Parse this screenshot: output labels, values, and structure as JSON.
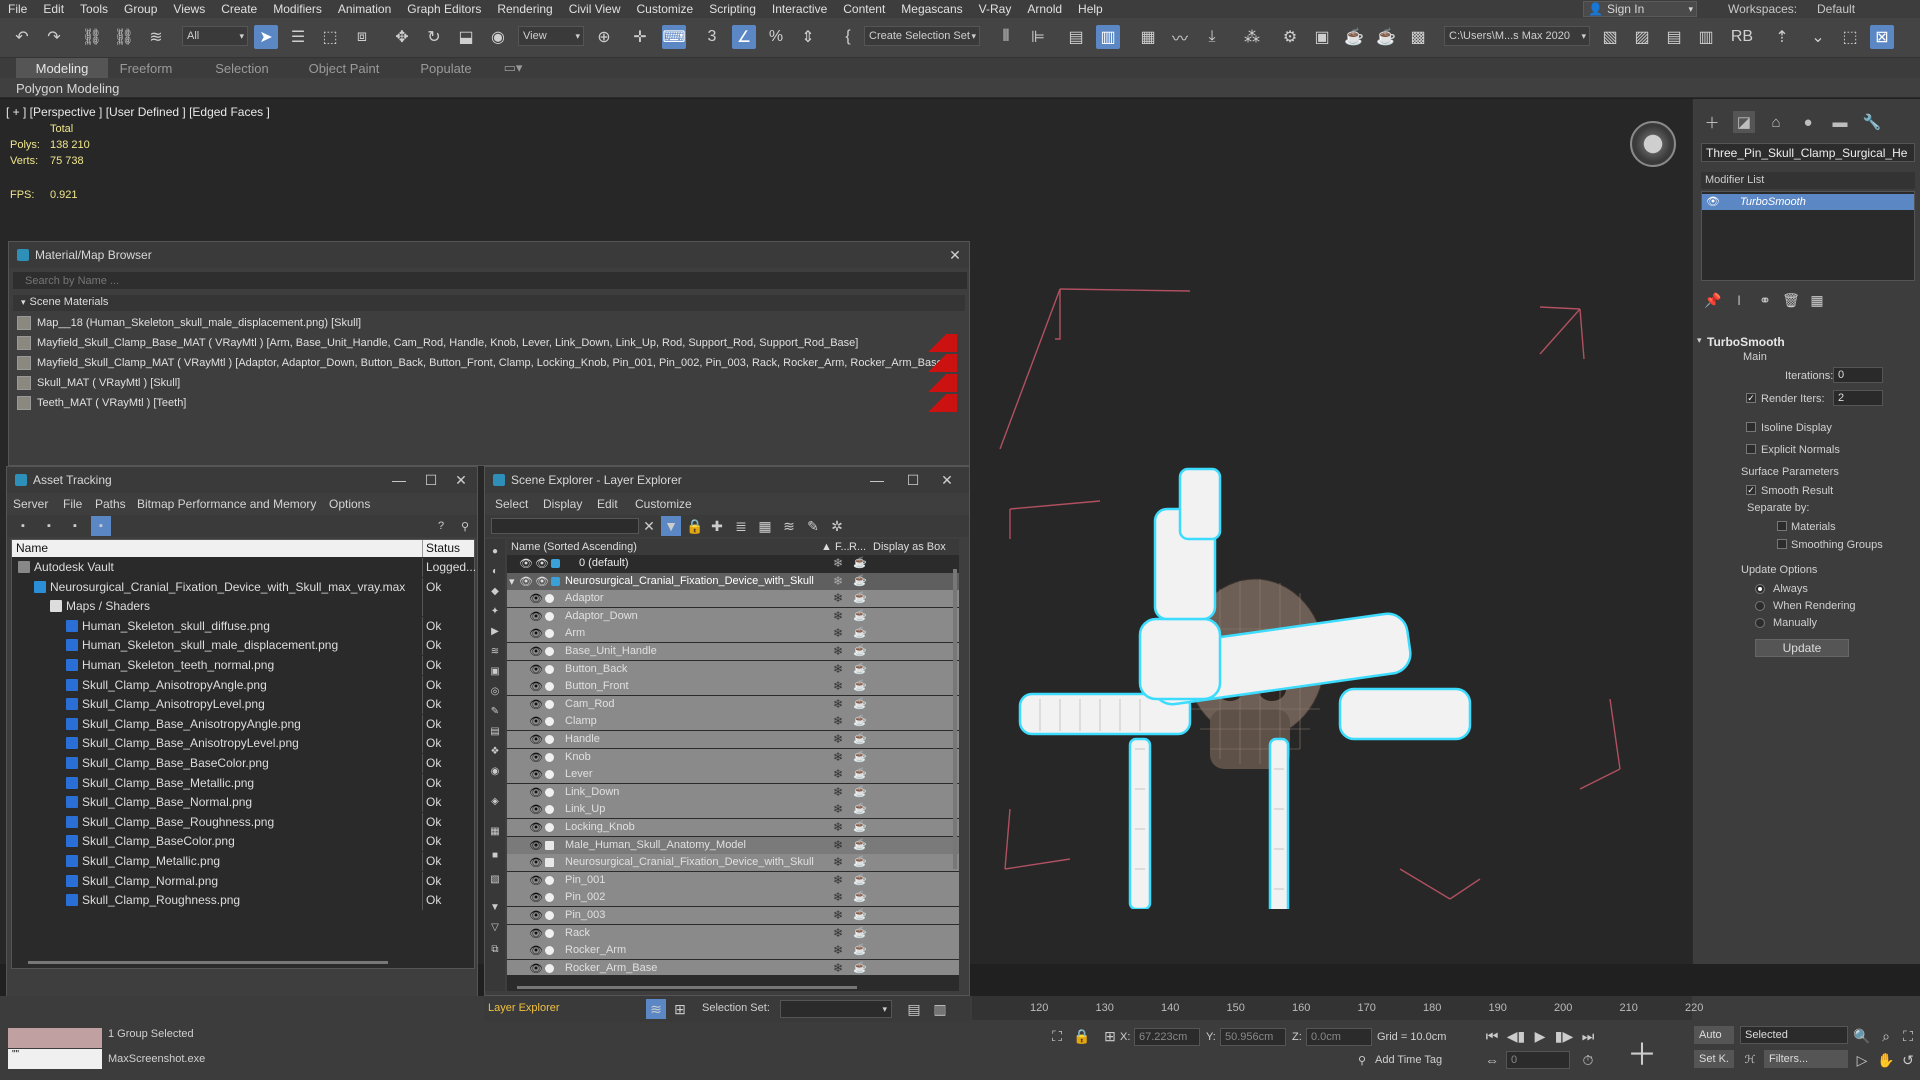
{
  "menubar": {
    "items": [
      "File",
      "Edit",
      "Tools",
      "Group",
      "Views",
      "Create",
      "Modifiers",
      "Animation",
      "Graph Editors",
      "Rendering",
      "Civil View",
      "Customize",
      "Scripting",
      "Interactive",
      "Content",
      "Megascans",
      "V-Ray",
      "Arnold",
      "Help"
    ],
    "signin": "Sign In",
    "workspaces_label": "Workspaces:",
    "workspace": "Default"
  },
  "toolbar": {
    "filter": "All",
    "view": "View",
    "selection_set": "Create Selection Set",
    "path": "C:\\Users\\M...s Max 2020",
    "snap_angle": "3"
  },
  "ribbon": {
    "tabs": [
      "Modeling",
      "Freeform",
      "Selection",
      "Object Paint",
      "Populate"
    ],
    "sub": "Polygon Modeling"
  },
  "viewport": {
    "label": "[ + ] [Perspective ] [User Defined ] [Edged Faces ]",
    "stats": {
      "total": "Total",
      "polys_label": "Polys:",
      "polys": "138 210",
      "verts_label": "Verts:",
      "verts": "75 738",
      "fps_label": "FPS:",
      "fps": "0.921"
    }
  },
  "cmd": {
    "object_name": "Three_Pin_Skull_Clamp_Surgical_He",
    "modifier_list": "Modifier List",
    "stack_item": "TurboSmooth",
    "rollout": "TurboSmooth",
    "main": "Main",
    "iterations_label": "Iterations:",
    "iterations": "0",
    "render_iters_label": "Render Iters:",
    "render_iters": "2",
    "isoline": "Isoline Display",
    "explicit": "Explicit Normals",
    "surface": "Surface Parameters",
    "smooth_result": "Smooth Result",
    "separate": "Separate by:",
    "materials": "Materials",
    "smoothing_groups": "Smoothing Groups",
    "update_options": "Update Options",
    "always": "Always",
    "when_rendering": "When Rendering",
    "manually": "Manually",
    "update": "Update"
  },
  "material_browser": {
    "title": "Material/Map Browser",
    "search": "Search by Name ...",
    "section": "Scene Materials",
    "rows": [
      "Map__18 (Human_Skeleton_skull_male_displacement.png) [Skull]",
      "Mayfield_Skull_Clamp_Base_MAT  ( VRayMtl )  [Arm, Base_Unit_Handle, Cam_Rod, Handle, Knob, Lever, Link_Down, Link_Up, Rod, Support_Rod, Support_Rod_Base]",
      "Mayfield_Skull_Clamp_MAT  ( VRayMtl )  [Adaptor, Adaptor_Down, Button_Back, Button_Front, Clamp, Locking_Knob, Pin_001, Pin_002, Pin_003, Rack, Rocker_Arm, Rocker_Arm_Base,...",
      "Skull_MAT  ( VRayMtl )  [Skull]",
      "Teeth_MAT  ( VRayMtl )  [Teeth]"
    ]
  },
  "asset_tracking": {
    "title": "Asset Tracking",
    "menu": [
      "Server",
      "File",
      "Paths",
      "Bitmap Performance and Memory",
      "Options"
    ],
    "col_name": "Name",
    "col_status": "Status",
    "rows": [
      {
        "name": "Autodesk Vault",
        "status": "Logged...",
        "indent": 0
      },
      {
        "name": "Neurosurgical_Cranial_Fixation_Device_with_Skull_max_vray.max",
        "status": "Ok",
        "indent": 1
      },
      {
        "name": "Maps / Shaders",
        "status": "",
        "indent": 2
      },
      {
        "name": "Human_Skeleton_skull_diffuse.png",
        "status": "Ok",
        "indent": 3
      },
      {
        "name": "Human_Skeleton_skull_male_displacement.png",
        "status": "Ok",
        "indent": 3
      },
      {
        "name": "Human_Skeleton_teeth_normal.png",
        "status": "Ok",
        "indent": 3
      },
      {
        "name": "Skull_Clamp_AnisotropyAngle.png",
        "status": "Ok",
        "indent": 3
      },
      {
        "name": "Skull_Clamp_AnisotropyLevel.png",
        "status": "Ok",
        "indent": 3
      },
      {
        "name": "Skull_Clamp_Base_AnisotropyAngle.png",
        "status": "Ok",
        "indent": 3
      },
      {
        "name": "Skull_Clamp_Base_AnisotropyLevel.png",
        "status": "Ok",
        "indent": 3
      },
      {
        "name": "Skull_Clamp_Base_BaseColor.png",
        "status": "Ok",
        "indent": 3
      },
      {
        "name": "Skull_Clamp_Base_Metallic.png",
        "status": "Ok",
        "indent": 3
      },
      {
        "name": "Skull_Clamp_Base_Normal.png",
        "status": "Ok",
        "indent": 3
      },
      {
        "name": "Skull_Clamp_Base_Roughness.png",
        "status": "Ok",
        "indent": 3
      },
      {
        "name": "Skull_Clamp_BaseColor.png",
        "status": "Ok",
        "indent": 3
      },
      {
        "name": "Skull_Clamp_Metallic.png",
        "status": "Ok",
        "indent": 3
      },
      {
        "name": "Skull_Clamp_Normal.png",
        "status": "Ok",
        "indent": 3
      },
      {
        "name": "Skull_Clamp_Roughness.png",
        "status": "Ok",
        "indent": 3
      }
    ]
  },
  "scene_explorer": {
    "title": "Scene Explorer - Layer Explorer",
    "menu": [
      "Select",
      "Display",
      "Edit",
      "Customize"
    ],
    "col_name": "Name (Sorted Ascending)",
    "col_f": "▲ F...",
    "col_r": "R...",
    "col_box": "Display as Box",
    "rows": [
      {
        "name": "0 (default)",
        "level": 0,
        "type": "layer"
      },
      {
        "name": "Neurosurgical_Cranial_Fixation_Device_with_Skull",
        "level": 0,
        "type": "layer-sel"
      },
      {
        "name": "Adaptor",
        "level": 1,
        "type": "obj"
      },
      {
        "name": "Adaptor_Down",
        "level": 1,
        "type": "obj"
      },
      {
        "name": "Arm",
        "level": 1,
        "type": "obj"
      },
      {
        "name": "Base_Unit_Handle",
        "level": 1,
        "type": "obj"
      },
      {
        "name": "Button_Back",
        "level": 1,
        "type": "obj"
      },
      {
        "name": "Button_Front",
        "level": 1,
        "type": "obj"
      },
      {
        "name": "Cam_Rod",
        "level": 1,
        "type": "obj"
      },
      {
        "name": "Clamp",
        "level": 1,
        "type": "obj"
      },
      {
        "name": "Handle",
        "level": 1,
        "type": "obj"
      },
      {
        "name": "Knob",
        "level": 1,
        "type": "obj"
      },
      {
        "name": "Lever",
        "level": 1,
        "type": "obj"
      },
      {
        "name": "Link_Down",
        "level": 1,
        "type": "obj"
      },
      {
        "name": "Link_Up",
        "level": 1,
        "type": "obj"
      },
      {
        "name": "Locking_Knob",
        "level": 1,
        "type": "obj"
      },
      {
        "name": "Male_Human_Skull_Anatomy_Model",
        "level": 1,
        "type": "group"
      },
      {
        "name": "Neurosurgical_Cranial_Fixation_Device_with_Skull",
        "level": 1,
        "type": "group"
      },
      {
        "name": "Pin_001",
        "level": 1,
        "type": "obj"
      },
      {
        "name": "Pin_002",
        "level": 1,
        "type": "obj"
      },
      {
        "name": "Pin_003",
        "level": 1,
        "type": "obj"
      },
      {
        "name": "Rack",
        "level": 1,
        "type": "obj"
      },
      {
        "name": "Rocker_Arm",
        "level": 1,
        "type": "obj"
      },
      {
        "name": "Rocker_Arm_Base",
        "level": 1,
        "type": "obj"
      }
    ]
  },
  "bottom": {
    "layer_explorer": "Layer Explorer",
    "selection_set": "Selection Set:",
    "group_selected": "1 Group Selected",
    "exe": "MaxScreenshot.exe",
    "x_label": "X:",
    "x": "67.223cm",
    "y_label": "Y:",
    "y": "50.956cm",
    "z_label": "Z:",
    "z": "0.0cm",
    "grid": "Grid = 10.0cm",
    "add_time_tag": "Add Time Tag",
    "auto": "Auto",
    "selected": "Selected",
    "setk": "Set K.",
    "filters": "Filters...",
    "frame": "0",
    "ticks": [
      "120",
      "130",
      "140",
      "150",
      "160",
      "170",
      "180",
      "190",
      "200",
      "210",
      "220"
    ]
  }
}
